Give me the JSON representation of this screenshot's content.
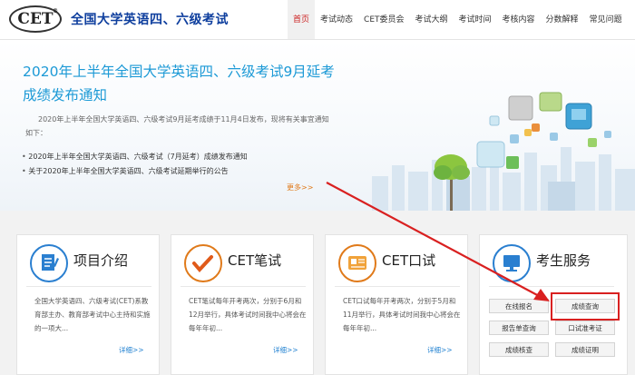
{
  "header": {
    "logo_text": "CET",
    "logo_mark": "®",
    "site_title": "全国大学英语四、六级考试",
    "nav": [
      {
        "label": "首页",
        "active": true
      },
      {
        "label": "考试动态"
      },
      {
        "label": "CET委员会"
      },
      {
        "label": "考试大纲"
      },
      {
        "label": "考试时间"
      },
      {
        "label": "考核内容"
      },
      {
        "label": "分数解释"
      },
      {
        "label": "常见问题"
      }
    ]
  },
  "banner": {
    "headline": "2020年上半年全国大学英语四、六级考试9月延考成绩发布通知",
    "lead": "2020年上半年全国大学英语四、六级考试9月延考成绩于11月4日发布，现将有关事宜通知如下：",
    "links": [
      "2020年上半年全国大学英语四、六级考试（7月延考）成绩发布通知",
      "关于2020年上半年全国大学英语四、六级考试延期举行的公告"
    ],
    "more": "更多>>"
  },
  "cards": [
    {
      "title": "项目介绍",
      "desc": "全国大学英语四、六级考试(CET)系教育部主办、教育部考试中心主持和实施的一项大...",
      "more": "详细>>",
      "icon": "document-icon"
    },
    {
      "title": "CET笔试",
      "desc": "CET笔试每年开考两次，分别于6月和12月举行，具体考试时间我中心将会在每年年初...",
      "more": "详细>>",
      "icon": "checkmark-icon"
    },
    {
      "title": "CET口试",
      "desc": "CET口试每年开考两次，分别于5月和11月举行，具体考试时间我中心将会在每年年初...",
      "more": "详细>>",
      "icon": "id-card-icon"
    },
    {
      "title": "考生服务",
      "icon": "computer-icon"
    }
  ],
  "services": {
    "online_registration": "在线报名",
    "score_query": "成绩查询",
    "cert_pending": "报告单查询",
    "oral_test": "口试准考证",
    "score_check": "成绩核查",
    "score_certificate": "成绩证明"
  },
  "colors": {
    "title_blue": "#0f3f9e",
    "headline_blue": "#1d9ad6",
    "more_orange": "#e07a1a",
    "highlight_red": "#d92020"
  }
}
